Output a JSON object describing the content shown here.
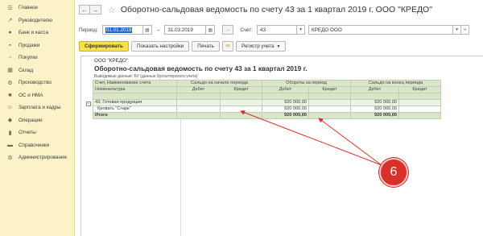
{
  "sidebar": {
    "items": [
      {
        "label": "Главное",
        "icon": "menu-icon"
      },
      {
        "label": "Руководителю",
        "icon": "chart-line-icon"
      },
      {
        "label": "Банк и касса",
        "icon": "bank-icon"
      },
      {
        "label": "Продажи",
        "icon": "cart-icon"
      },
      {
        "label": "Покупки",
        "icon": "basket-icon"
      },
      {
        "label": "Склад",
        "icon": "warehouse-icon"
      },
      {
        "label": "Производство",
        "icon": "factory-icon"
      },
      {
        "label": "ОС и НМА",
        "icon": "assets-icon"
      },
      {
        "label": "Зарплата и кадры",
        "icon": "people-icon"
      },
      {
        "label": "Операции",
        "icon": "operations-icon"
      },
      {
        "label": "Отчеты",
        "icon": "reports-icon"
      },
      {
        "label": "Справочники",
        "icon": "book-icon"
      },
      {
        "label": "Администрирование",
        "icon": "gear-icon"
      }
    ]
  },
  "header": {
    "title": "Оборотно-сальдовая ведомость по счету 43 за 1 квартал 2019 г. ООО \"КРЕДО\""
  },
  "params": {
    "period_label": "Период:",
    "date_from": "01.01.2019",
    "dash": "–",
    "date_to": "31.03.2019",
    "more": "...",
    "account_label": "Счет:",
    "account": "43",
    "org": "КРЕДО ООО"
  },
  "toolbar": {
    "generate": "Сформировать",
    "show_settings": "Показать настройки",
    "print": "Печать",
    "registry": "Регистр учета"
  },
  "report": {
    "org": "ООО \"КРЕДО\"",
    "title": "Оборотно-сальдовая ведомость по счету 43 за 1 квартал 2019 г.",
    "subtitle": "Выводимые данные:  БУ (данные бухгалтерского учета)",
    "header": {
      "col_account": "Счет, Наименование счета",
      "col_nomenclature": "Номенклатура",
      "start_balance": "Сальдо на начало периода",
      "turnover": "Обороты за период",
      "end_balance": "Сальдо на конец периода",
      "debit": "Дебет",
      "credit": "Кредит"
    },
    "rows": [
      {
        "name": "43, Готовая продукция",
        "start_debit": "",
        "start_credit": "",
        "turn_debit": "920 000,00",
        "turn_credit": "",
        "end_debit": "920 000,00",
        "end_credit": ""
      },
      {
        "name": "Кровать \"Старк\"",
        "start_debit": "",
        "start_credit": "",
        "turn_debit": "920 000,00",
        "turn_credit": "",
        "end_debit": "920 000,00",
        "end_credit": ""
      }
    ],
    "total": {
      "name": "Итого",
      "turn_debit": "920 000,00",
      "end_debit": "920 000,00"
    }
  },
  "annotation": {
    "number": "6",
    "color": "#d9302c"
  }
}
